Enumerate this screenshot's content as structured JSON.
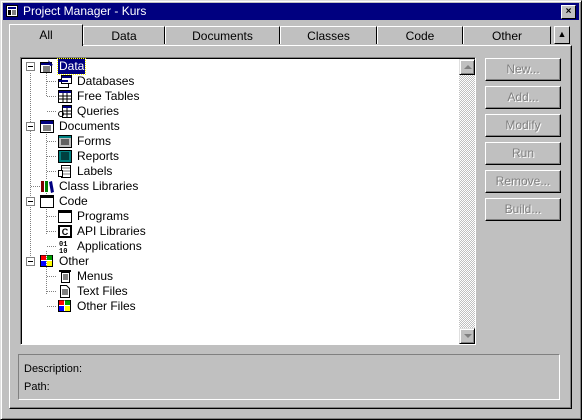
{
  "window": {
    "title": "Project Manager - Kurs",
    "close_glyph": "×"
  },
  "tabs": [
    {
      "label": "All",
      "active": true
    },
    {
      "label": "Data"
    },
    {
      "label": "Documents"
    },
    {
      "label": "Classes"
    },
    {
      "label": "Code"
    },
    {
      "label": "Other"
    }
  ],
  "tab_scroll_glyph": "▲",
  "tree": {
    "items": [
      {
        "label": "Data",
        "icon": "data-icon",
        "selected": true
      },
      {
        "label": "Databases",
        "icon": "databases-icon"
      },
      {
        "label": "Free Tables",
        "icon": "table-icon"
      },
      {
        "label": "Queries",
        "icon": "query-icon"
      },
      {
        "label": "Documents",
        "icon": "documents-icon"
      },
      {
        "label": "Forms",
        "icon": "form-icon"
      },
      {
        "label": "Reports",
        "icon": "report-icon"
      },
      {
        "label": "Labels",
        "icon": "labels-icon"
      },
      {
        "label": "Class Libraries",
        "icon": "class-library-icon"
      },
      {
        "label": "Code",
        "icon": "code-icon"
      },
      {
        "label": "Programs",
        "icon": "program-icon"
      },
      {
        "label": "API Libraries",
        "icon": "api-library-icon"
      },
      {
        "label": "Applications",
        "icon": "application-icon"
      },
      {
        "label": "Other",
        "icon": "other-icon"
      },
      {
        "label": "Menus",
        "icon": "menu-icon"
      },
      {
        "label": "Text Files",
        "icon": "text-file-icon"
      },
      {
        "label": "Other Files",
        "icon": "other-files-icon"
      }
    ]
  },
  "buttons": {
    "new": "New...",
    "add": "Add...",
    "modify": "Modify",
    "run": "Run",
    "remove": "Remove...",
    "build": "Build..."
  },
  "info": {
    "description_label": "Description:",
    "path_label": "Path:"
  },
  "colors": {
    "face": "#c0c0c0",
    "title_bar": "#000080",
    "selection": "#000080",
    "disabled_text": "#808080"
  }
}
